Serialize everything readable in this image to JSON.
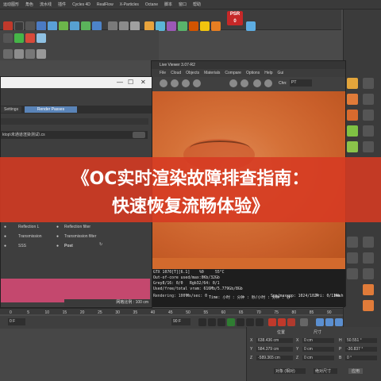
{
  "menu": [
    "",
    "运动图形",
    "角色",
    "流水线",
    "插件",
    "Cycles 4D",
    "RealFlow",
    "X-Particles",
    "Octane",
    "脚本",
    "窗口",
    "帮助"
  ],
  "psr": {
    "line1": "PSR",
    "line2": "0"
  },
  "live_viewer": {
    "title": "Live Viewer 3.07-R2",
    "menu": [
      "File",
      "Cloud",
      "Objects",
      "Materials",
      "Compare",
      "Options",
      "Help",
      "Gui"
    ],
    "channel_label": "Chn:",
    "channel_value": "PT",
    "status": {
      "gpu": "GTX 1070[T][6.1]",
      "util": "%0",
      "temp": "55°C",
      "ooc": "Out-of-core used/max:0Kb/32Gb",
      "grey": "Grey8/16: 0/0",
      "rgb": "Rgb32/64: 0/1",
      "vram": "Used/free/total vram: 616Mb/5.779Gb/8Gb",
      "rendering": "Rendering: 100%",
      "ms": "Ms/sec: 0",
      "time": "Time: 小时 : 分钟 : 秒/小时 : 分钟 : 秒",
      "spp": "Spp/maxspp: 1024/1024",
      "tri": "Tri: 0/114k",
      "mesh": "Mesh"
    }
  },
  "render_settings": {
    "tabs": [
      "Settings",
      "Render Passes"
    ],
    "path": "ktop\\未通道渲染测试\\.cs",
    "passes": {
      "col1": [
        "Reflection L",
        "Transmission",
        "SSS"
      ],
      "col2": [
        "Reflection filter",
        "Transmission filter",
        "Post"
      ]
    },
    "footer": "网格比例 : 100 cm"
  },
  "banner": {
    "line1": "《OC实时渲染故障排查指南：",
    "line2": "快速恢复流畅体验》"
  },
  "timeline": {
    "ticks": [
      "0",
      "5",
      "10",
      "15",
      "20",
      "25",
      "30",
      "35",
      "40",
      "45",
      "50",
      "55",
      "60",
      "65",
      "70",
      "75",
      "80",
      "85",
      "90"
    ],
    "frame_start": "0 F",
    "frame_end": "90 F"
  },
  "coords": {
    "header_pos": "位置",
    "header_size": "尺寸",
    "rows": [
      {
        "axis": "X",
        "pos": "638.436 cm",
        "sz_axis": "X",
        "size": "0 cm",
        "rot_axis": "H",
        "rot": "50.551 °"
      },
      {
        "axis": "Y",
        "pos": "584.379 cm",
        "sz_axis": "Y",
        "size": "0 cm",
        "rot_axis": "P",
        "rot": "-30.837 °"
      },
      {
        "axis": "Z",
        "pos": "-589.365 cm",
        "sz_axis": "Z",
        "size": "0 cm",
        "rot_axis": "B",
        "rot": "0 °"
      }
    ],
    "mode": "对象 (相对)",
    "size_mode": "绝对尺寸",
    "apply": "应用"
  }
}
